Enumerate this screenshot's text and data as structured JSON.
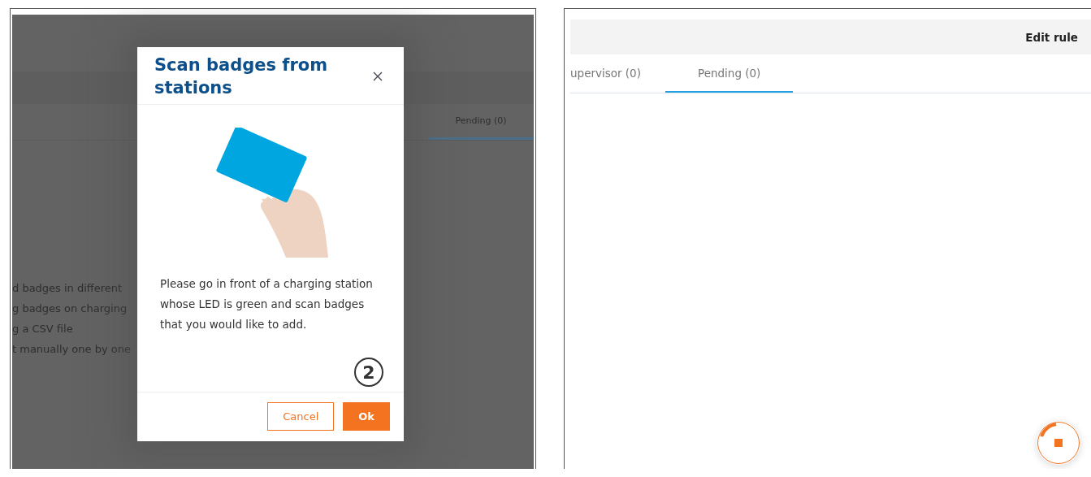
{
  "left_panel": {
    "background": {
      "tab": {
        "label": "Pending (0)",
        "selected": true
      },
      "text_lines": [
        "d badges in different",
        "g badges on charging",
        "g a CSV file",
        "t manually one by one"
      ]
    },
    "dialog": {
      "title": "Scan badges from stations",
      "message": "Please go in front of a charging station whose LED is green and scan badges that you would like to add.",
      "step_marker": "2",
      "buttons": [
        {
          "label": "Cancel",
          "kind": "secondary"
        },
        {
          "label": "Ok",
          "kind": "primary"
        }
      ]
    }
  },
  "right_panel": {
    "toolbar": {
      "title": "Edit rule"
    },
    "tabs": [
      {
        "label": "upervisor (0)",
        "selected": false
      },
      {
        "label": "Pending (0)",
        "selected": true
      }
    ]
  }
}
